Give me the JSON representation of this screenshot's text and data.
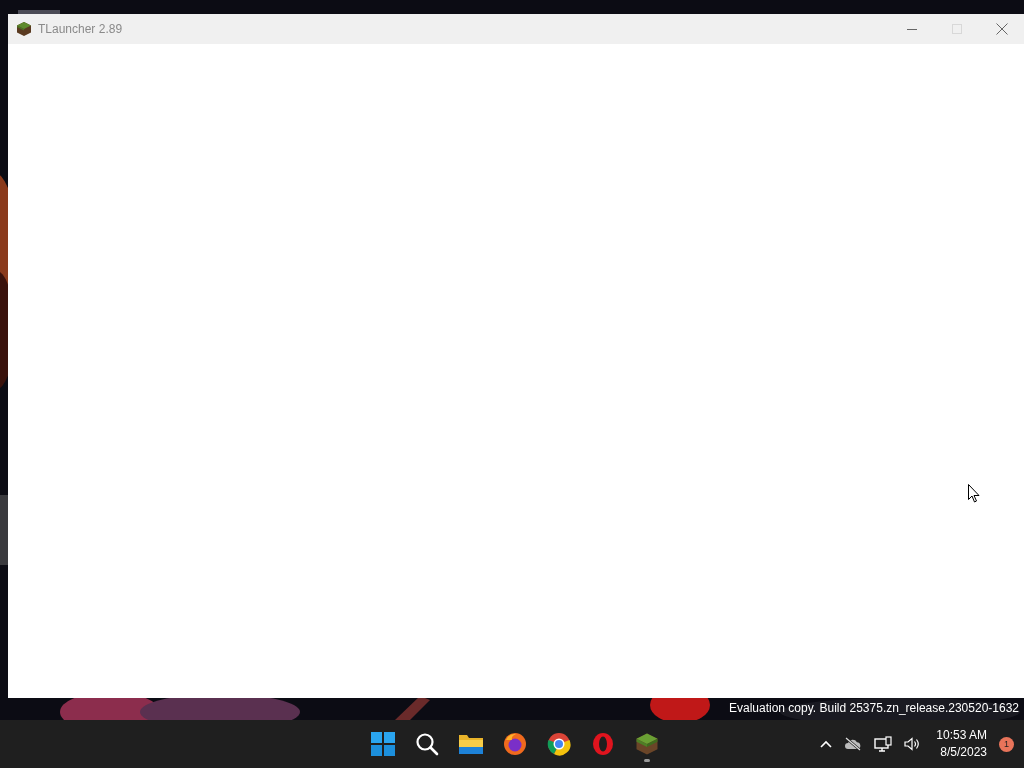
{
  "window": {
    "title": "TLauncher 2.89",
    "controls": [
      {
        "kind": "minimize",
        "disabled": false
      },
      {
        "kind": "maximize",
        "disabled": true
      },
      {
        "kind": "close",
        "disabled": false
      }
    ]
  },
  "desktop": {
    "watermark": "Evaluation copy. Build 25375.zn_release.230520-1632"
  },
  "taskbar": {
    "apps": [
      {
        "kind": "start",
        "running": false
      },
      {
        "kind": "search",
        "running": false
      },
      {
        "kind": "folder",
        "running": false
      },
      {
        "kind": "firefox",
        "running": false
      },
      {
        "kind": "chrome",
        "running": false
      },
      {
        "kind": "opera",
        "running": false
      },
      {
        "kind": "cube",
        "running": true
      }
    ],
    "tray": {
      "icons": [
        {
          "kind": "chevron"
        },
        {
          "kind": "cloud-off"
        },
        {
          "kind": "network"
        },
        {
          "kind": "volume"
        }
      ],
      "time": "10:53 AM",
      "date": "8/5/2023",
      "notification_count": "1"
    }
  }
}
